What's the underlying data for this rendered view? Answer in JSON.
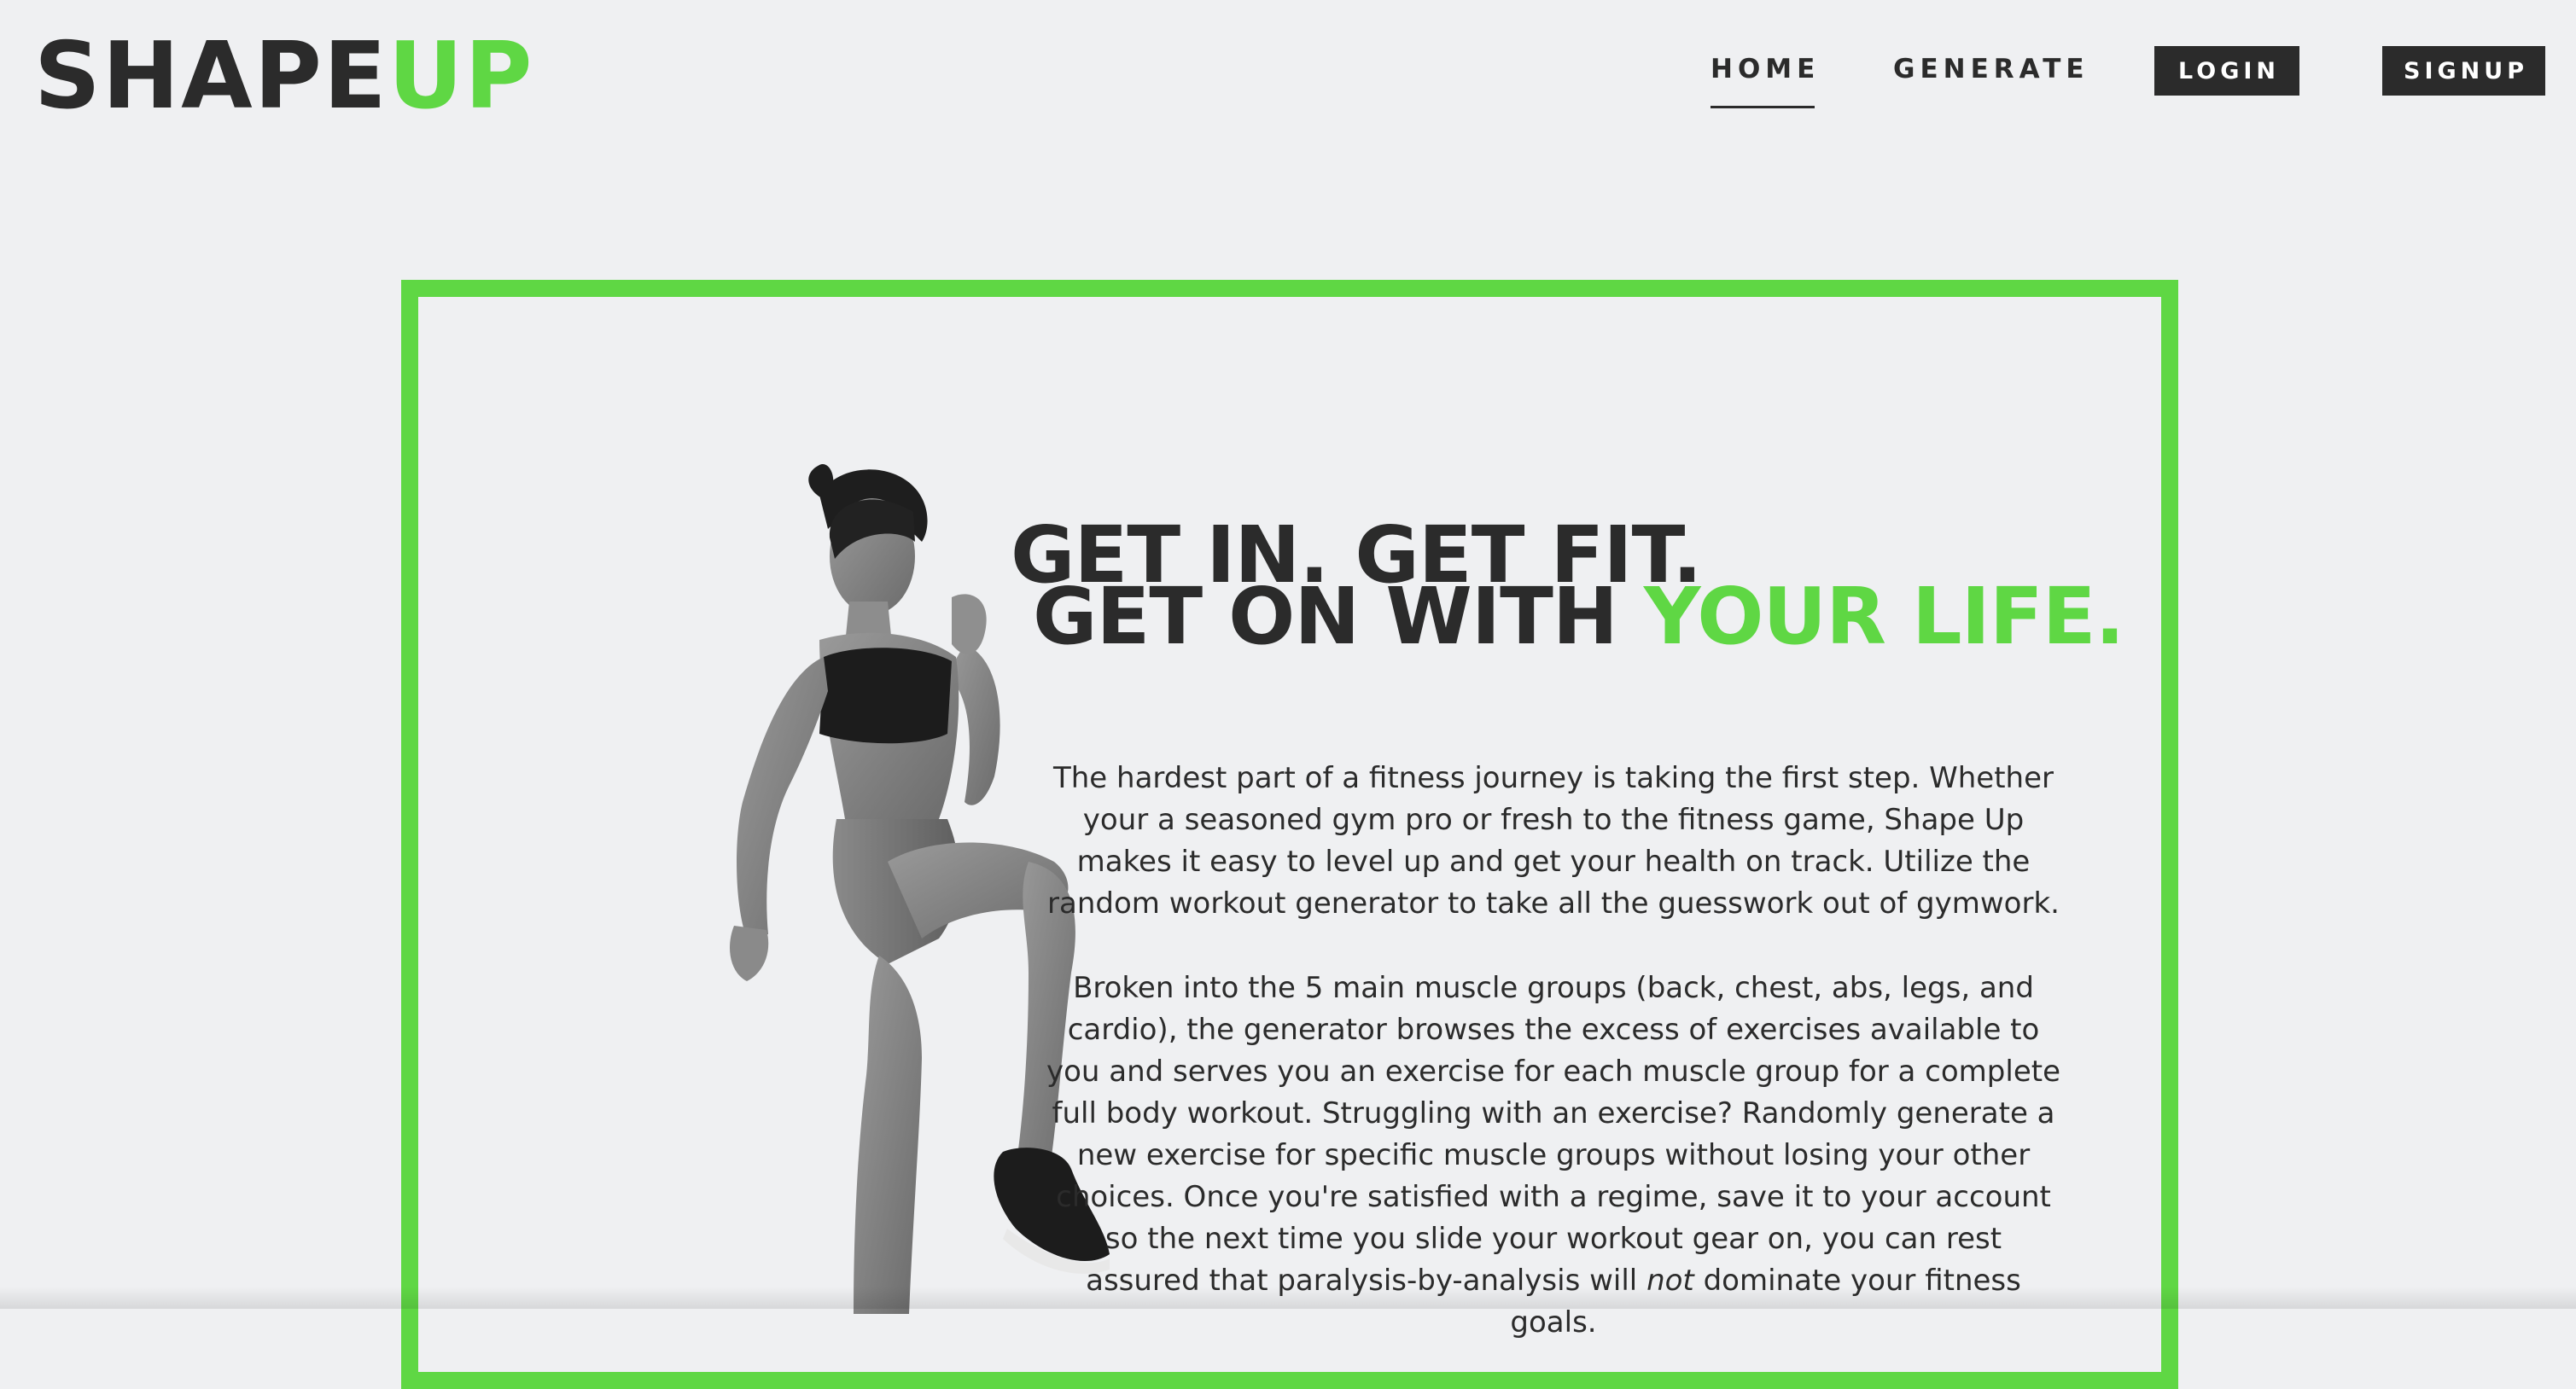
{
  "brand": {
    "logo_part1": "SHAPE",
    "logo_part2": "UP",
    "accent_color": "#5fd744",
    "dark_color": "#2b2b2b",
    "background_color": "#eff0f2"
  },
  "nav": {
    "home_label": "HOME",
    "generate_label": "GENERATE",
    "login_label": "LOGIN",
    "signup_label": "SIGNUP",
    "active": "HOME"
  },
  "hero": {
    "headline_line1": "GET IN. GET FIT.",
    "headline_line2_start": "GET ON WITH ",
    "headline_line2_accent": "YOUR LIFE.",
    "paragraph1": "The hardest part of a fitness journey is taking the first step. Whether your a seasoned gym pro or fresh to the fitness game, Shape Up makes it easy to level up and get your health on track. Utilize the random workout generator to take all the guesswork out of gymwork.",
    "paragraph2_before": "Broken into the 5 main muscle groups (back, chest, abs, legs, and cardio), the generator browses the excess of exercises available to you and serves you an exercise for each muscle group for a complete full body workout. Struggling with an exercise? Randomly generate a new exercise for specific muscle groups without losing your other choices. Once you're satisfied with a regime, save it to your account so the next time you slide your workout gear on, you can rest assured that paralysis-by-analysis will ",
    "paragraph2_emphasis": "not",
    "paragraph2_after": " dominate your fitness goals.",
    "image": "athlete-woman-high-knee-photo"
  }
}
